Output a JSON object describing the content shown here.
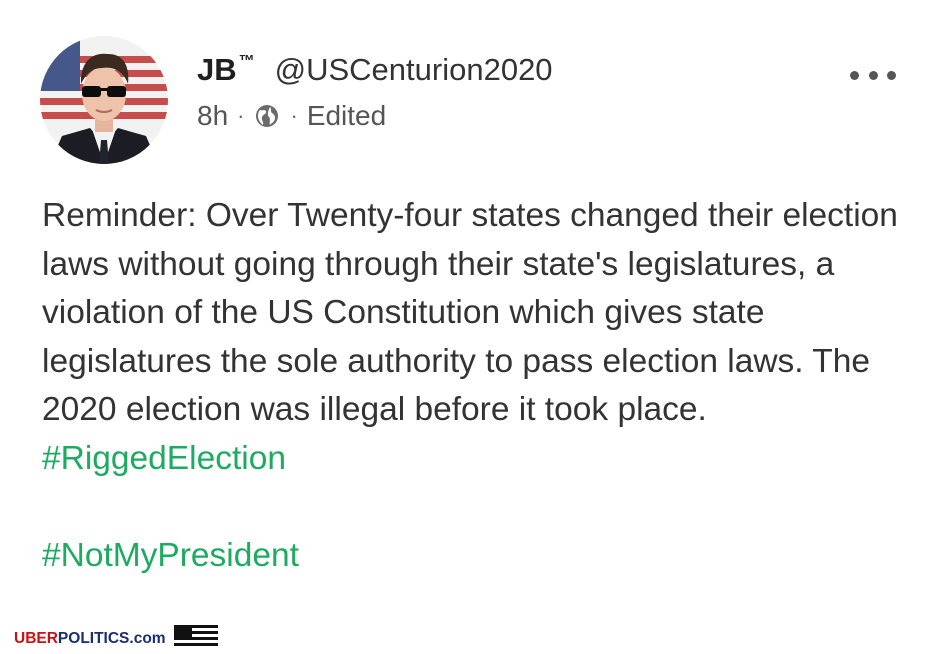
{
  "post": {
    "author": {
      "display_name": "JB",
      "trademark": "™",
      "handle": "@USCenturion2020",
      "avatar_icon": "profile-photo"
    },
    "meta": {
      "time": "8h",
      "separator": "·",
      "visibility_icon": "globe-icon",
      "edited": "Edited"
    },
    "more_icon": "more-dots-icon",
    "body": {
      "text": "Reminder: Over Twenty-four states changed their election laws without going through their state's legislatures, a violation of the US Constitution which gives state legislatures the sole authority to pass election laws. The 2020 election was illegal before it took place.",
      "hashtags": [
        "#RiggedElection",
        "#NotMyPresident"
      ]
    },
    "hashtag_color": "#1daa61"
  },
  "watermark": {
    "part1": "UBER",
    "part2": "POLITICS.com",
    "flag_icon": "us-flag-icon"
  }
}
